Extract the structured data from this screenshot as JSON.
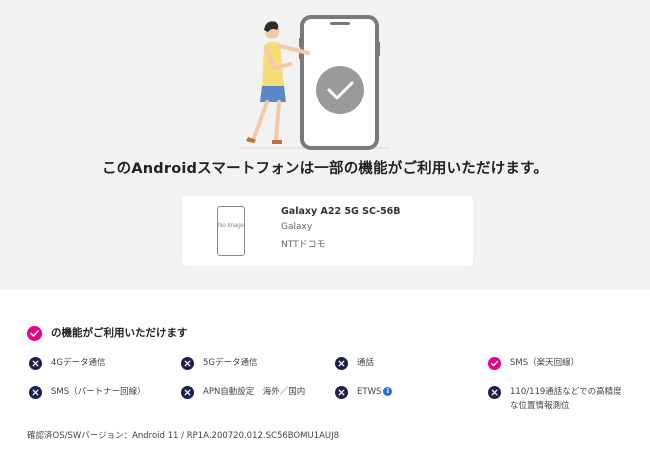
{
  "headline": "このAndroidスマートフォンは一部の機能がご利用いただけます。",
  "device": {
    "thumbnail_text": "No Image",
    "name": "Galaxy A22 5G SC-56B",
    "brand": "Galaxy",
    "carrier": "NTTドコモ"
  },
  "features": {
    "title": "の機能がご利用いただけます",
    "items": [
      {
        "label": "4Gデータ通信",
        "available": false
      },
      {
        "label": "5Gデータ通信",
        "available": false
      },
      {
        "label": "通話",
        "available": false
      },
      {
        "label": "SMS（楽天回線）",
        "available": true
      },
      {
        "label": "SMS（パートナー回線）",
        "available": false
      },
      {
        "label": "APN自動設定　海外／国内",
        "available": false
      },
      {
        "label": "ETWS",
        "available": false,
        "info_icon": "info-icon"
      },
      {
        "label": "110/119通話などでの高精度な位置情報測位",
        "available": false
      }
    ]
  },
  "os_info": "確認済OS/SWバージョン：Android 11 / RP1A.200720.012.SC56BOMU1AUJ8",
  "colors": {
    "hero_bg": "#f2f2f2",
    "available": "#e5008a",
    "unavailable": "#1c1f4e",
    "info": "#2c6fd6"
  }
}
